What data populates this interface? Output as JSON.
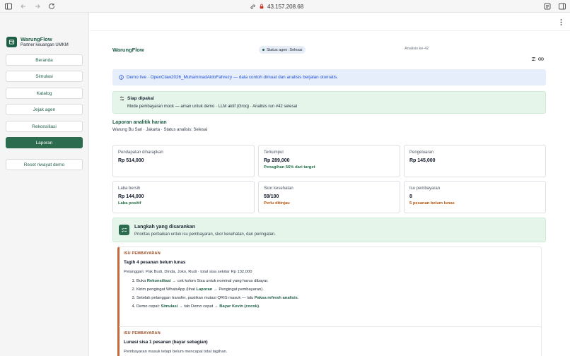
{
  "browser": {
    "url": "43.157.208.68"
  },
  "sidebar": {
    "brand_title": "WarungFlow",
    "brand_subtitle": "Partner keuangan UMKM",
    "items": [
      {
        "label": "Beranda"
      },
      {
        "label": "Simulasi"
      },
      {
        "label": "Katalog"
      },
      {
        "label": "Jejak agen"
      },
      {
        "label": "Rekonsiliasi"
      },
      {
        "label": "Laporan"
      }
    ],
    "reset_label": "Reset riwayat demo"
  },
  "header": {
    "app_title": "WarungFlow",
    "status": "Status agen: Selesai",
    "run": "Analisis ke-42"
  },
  "demo_banner": "Demo live · OpenClaw2026_MuhammadAldoFahrezy — data contoh dimuat dan analisis berjalan otomatis.",
  "ready": {
    "title": "Siap dipakai",
    "subtitle": "Mode pembayaran mock — aman untuk demo · LLM aktif (Groq) · Analisis run #42 selesai"
  },
  "report": {
    "title": "Laporan analitik harian",
    "subtitle": "Warung Bu Sari · Jakarta · Status analisis: Selesai"
  },
  "cards": [
    {
      "label": "Pendapatan diharapkan",
      "value": "Rp 514,000",
      "note": ""
    },
    {
      "label": "Terkumpul",
      "value": "Rp 289,000",
      "note": "Penagihan 56% dari target"
    },
    {
      "label": "Pengeluaran",
      "value": "Rp 145,000",
      "note": ""
    },
    {
      "label": "Laba bersih",
      "value": "Rp 144,000",
      "note": "Laba positif"
    },
    {
      "label": "Skor kesehatan",
      "value": "59/100",
      "note": "Perlu ditinjau"
    },
    {
      "label": "Isu pembayaran",
      "value": "8",
      "note": "5 pesanan belum lunas"
    }
  ],
  "steps": {
    "title": "Langkah yang disarankan",
    "subtitle": "Prioritas perbaikan untuk isu pembayaran, skor kesehatan, dan peringatan."
  },
  "issues": [
    {
      "tag": "ISU PEMBAYARAN",
      "title": "Tagih 4 pesanan belum lunas",
      "meta": "Pelanggan: Pak Budi, Dinda, Joko, Rudi · total sisa sekitar Rp 132,000",
      "steps": {
        "s1a": "Buka ",
        "s1k": "Rekonsiliasi",
        "s1b": " → cek kolom Sisa untuk nominal yang harus dibayar.",
        "s2a": "Kirim pengingat WhatsApp (lihat ",
        "s2k": "Laporan",
        "s2b": " → Pengingat pembayaran).",
        "s3a": "Setelah pelanggan transfer, pastikan mutasi QRIS masuk — lalu ",
        "s3k": "Paksa refresh analisis",
        "s3b": ".",
        "s4a": "Demo cepat: ",
        "s4k": "Simulasi",
        "s4b": " → tab Demo cepat → ",
        "s4k2": "Bayar Kevin (cocok)",
        "s4c": "."
      }
    },
    {
      "tag": "ISU PEMBAYARAN",
      "title": "Lunasi sisa 1 pesanan (bayar sebagian)",
      "meta": "Pembayaran masuk tetapi belum mencapai total tagihan."
    }
  ]
}
